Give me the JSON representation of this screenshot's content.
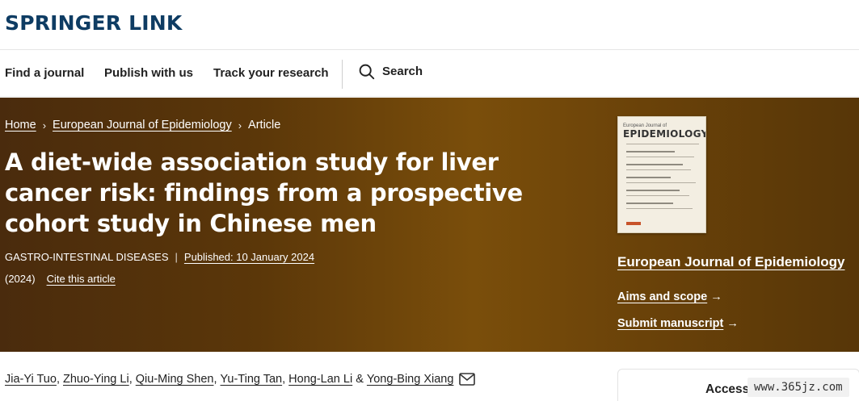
{
  "brand": {
    "logo_text": "SPRINGER LINK",
    "color": "#0e3c63"
  },
  "nav": {
    "items": [
      "Find a journal",
      "Publish with us",
      "Track your research"
    ],
    "search_label": "Search",
    "search_icon": "search-icon"
  },
  "breadcrumb": {
    "items": [
      "Home",
      "European Journal of Epidemiology",
      "Article"
    ]
  },
  "article": {
    "title": "A diet-wide association study for liver cancer risk: findings from a prospective cohort study in Chinese men",
    "category": "GASTRO-INTESTINAL DISEASES",
    "published": "Published: 10 January 2024",
    "year": "(2024)",
    "cite": "Cite this article"
  },
  "journal_panel": {
    "cover_small": "European Journal of",
    "cover_title": "EPIDEMIOLOGY",
    "name": "European Journal of Epidemiology",
    "links": [
      "Aims and scope",
      "Submit manuscript"
    ],
    "arrow": "→"
  },
  "authors": {
    "names": [
      "Jia-Yi Tuo",
      "Zhuo-Ying Li",
      "Qiu-Ming Shen",
      "Yu-Ting Tan",
      "Hong-Lan Li",
      "Yong-Bing Xiang"
    ],
    "separator": ", ",
    "last_separator": " & ",
    "icon": "mail-icon"
  },
  "access_box": {
    "label": "Access th"
  },
  "watermark": {
    "text": "www.365jz.com"
  },
  "colors": {
    "hero_start": "#4a2b0d",
    "hero_mid": "#7a4e0b",
    "hero_end": "#573608"
  }
}
